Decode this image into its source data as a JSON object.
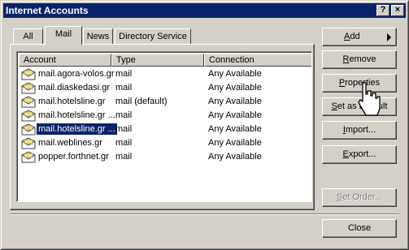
{
  "window": {
    "title": "Internet Accounts",
    "help_label": "?",
    "close_label": "×"
  },
  "tabs": [
    {
      "label": "All"
    },
    {
      "label": "Mail"
    },
    {
      "label": "News"
    },
    {
      "label": "Directory Service"
    }
  ],
  "list": {
    "columns": [
      "Account",
      "Type",
      "Connection"
    ],
    "rows": [
      {
        "account": "mail.agora-volos.gr",
        "type": "mail",
        "connection": "Any Available"
      },
      {
        "account": "mail.diaskedasi.gr",
        "type": "mail",
        "connection": "Any Available"
      },
      {
        "account": "mail.hotelsline.gr",
        "type": "mail (default)",
        "connection": "Any Available"
      },
      {
        "account": "mail.hotelsline.gr ...",
        "type": "mail",
        "connection": "Any Available"
      },
      {
        "account": "mail.hotelsline.gr ...",
        "type": "mail",
        "connection": "Any Available",
        "selected": true
      },
      {
        "account": "mail.weblines.gr",
        "type": "mail",
        "connection": "Any Available"
      },
      {
        "account": "popper.forthnet.gr",
        "type": "mail",
        "connection": "Any Available"
      }
    ]
  },
  "buttons": {
    "add": {
      "pre": "",
      "key": "A",
      "post": "dd"
    },
    "remove": {
      "pre": "",
      "key": "R",
      "post": "emove"
    },
    "properties": {
      "pre": "",
      "key": "P",
      "post": "roperties"
    },
    "set_default": {
      "pre": "",
      "key": "S",
      "post": "et as Default"
    },
    "import": {
      "pre": "",
      "key": "I",
      "post": "mport..."
    },
    "export": {
      "pre": "",
      "key": "E",
      "post": "xport..."
    },
    "set_order": {
      "pre": "",
      "key": "S",
      "post": "et Order..."
    },
    "close": {
      "pre": "Close",
      "key": "",
      "post": ""
    }
  }
}
